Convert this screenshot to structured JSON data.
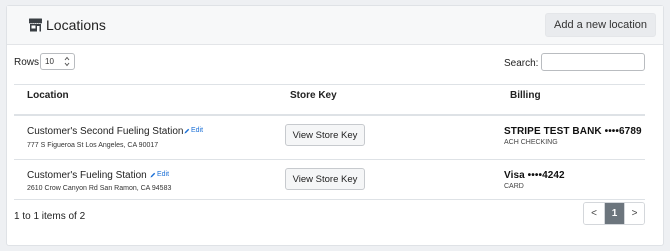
{
  "header": {
    "title": "Locations",
    "title_icon": "store-icon",
    "add_button_label": "Add a new location"
  },
  "controls": {
    "rows_label": "Rows",
    "rows_value": "10",
    "search_label": "Search:",
    "search_value": ""
  },
  "table": {
    "columns": [
      "Location",
      "Store Key",
      "Billing"
    ],
    "rows": [
      {
        "name": "Customer's Second Fueling Station",
        "edit_label": "Edit",
        "address": "777 S Figueroa St Los Angeles, CA 90017",
        "store_key_button": "View Store Key",
        "billing_main": "STRIPE TEST BANK ••••6789",
        "billing_sub": "ACH CHECKING"
      },
      {
        "name": "Customer's Fueling Station",
        "edit_label": "Edit",
        "address": "2610 Crow Canyon Rd San Ramon, CA 94583",
        "store_key_button": "View Store Key",
        "billing_main": "Visa ••••4242",
        "billing_sub": "CARD"
      }
    ]
  },
  "footer": {
    "count_text": "1 to 1 items of 2",
    "prev_label": "<",
    "current_page": "1",
    "next_label": ">"
  },
  "colors": {
    "accent_link": "#1a6fd6",
    "active_page": "#6c757d"
  }
}
